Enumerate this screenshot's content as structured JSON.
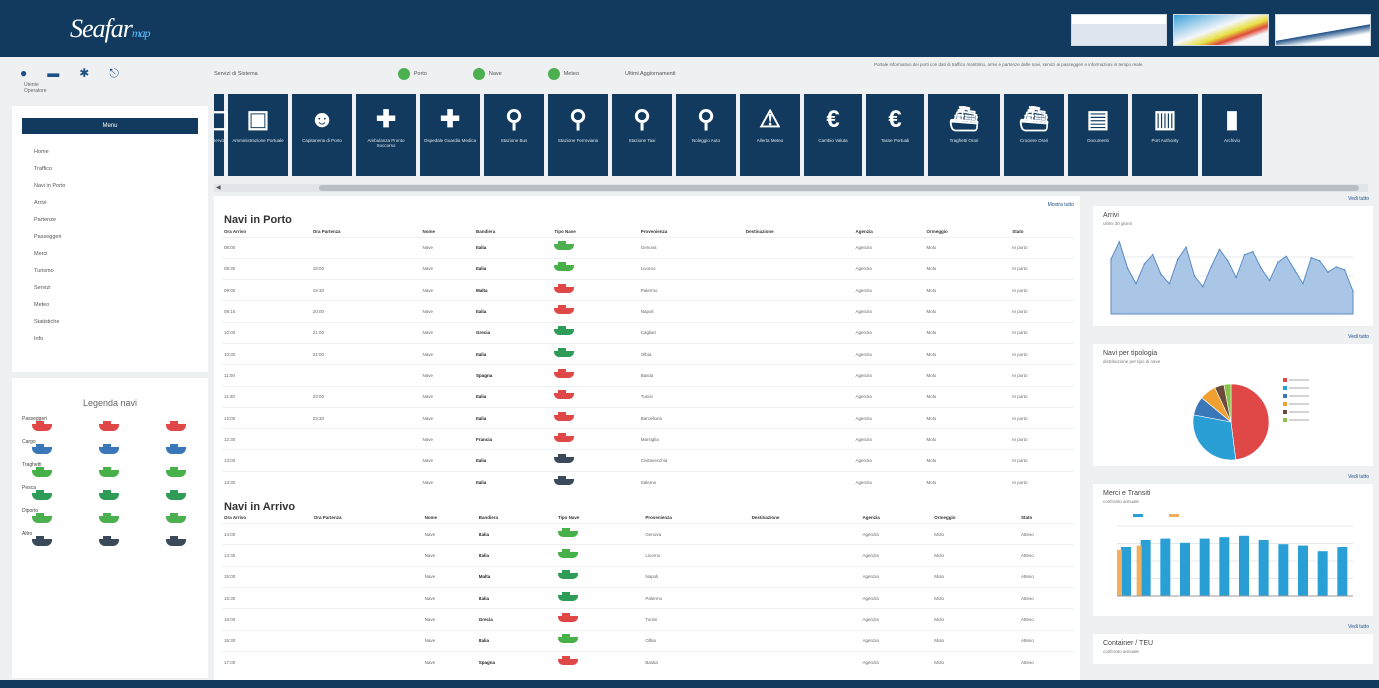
{
  "header": {
    "logo_main": "Seafar",
    "logo_suffix": "map"
  },
  "partners": [
    "partner-logo-1",
    "partner-logo-2",
    "partner-logo-3"
  ],
  "status": {
    "label_left": "Servizi di Sistema",
    "services": [
      "Porto",
      "Nave",
      "Meteo"
    ],
    "label_right": "Ultimi Aggiornamenti",
    "news": "Portale informativo dei porti con dati di traffico marittimo, arrivi e partenze delle navi, servizi ai passeggeri e informazioni in tempo reale."
  },
  "user": {
    "name": "Utente",
    "role": "Operatore"
  },
  "sidebar": {
    "header": "Menu",
    "items": [
      "Home",
      "Traffico",
      "Navi in Porto",
      "Arrivi",
      "Partenze",
      "Passeggeri",
      "Merci",
      "Turismo",
      "Servizi",
      "Meteo",
      "Statistiche",
      "Info"
    ]
  },
  "legend": {
    "title": "Legenda navi",
    "groups": [
      {
        "name": "Passeggeri",
        "color": "#e04848"
      },
      {
        "name": "Cargo",
        "color": "#3a77b8"
      },
      {
        "name": "Traghetti",
        "color": "#48b048"
      },
      {
        "name": "Pesca",
        "color": "#2e9c56"
      },
      {
        "name": "Diporto",
        "color": "#4caf50"
      },
      {
        "name": "Altro",
        "color": "#3a4a5a"
      }
    ]
  },
  "toolbar": [
    {
      "icon": "▢",
      "label": "Servizi"
    },
    {
      "icon": "▣",
      "label": "Amministrazione Portuale"
    },
    {
      "icon": "☻",
      "label": "Capitaneria di Porto"
    },
    {
      "icon": "✚",
      "label": "Ambulanza Pronto Soccorso"
    },
    {
      "icon": "✚",
      "label": "Ospedale Guardia Medica"
    },
    {
      "icon": "⚲",
      "label": "Stazione Bus"
    },
    {
      "icon": "⚲",
      "label": "Stazione Ferroviaria"
    },
    {
      "icon": "⚲",
      "label": "Stazione Taxi"
    },
    {
      "icon": "⚲",
      "label": "Noleggio Auto"
    },
    {
      "icon": "⚠",
      "label": "Allerta Meteo"
    },
    {
      "icon": "€",
      "label": "Cambio Valuta"
    },
    {
      "icon": "€",
      "label": "Tasse Portuali"
    },
    {
      "icon": "⛴",
      "label": "Traghetti Orari"
    },
    {
      "icon": "⛴",
      "label": "Crociere Orari"
    },
    {
      "icon": "▤",
      "label": "Documenti"
    },
    {
      "icon": "▥",
      "label": "Port Authority"
    },
    {
      "icon": "▮",
      "label": "Archivio"
    }
  ],
  "main": {
    "link": "Mostra tutto",
    "in_port": {
      "title": "Navi in Porto",
      "columns": [
        "Ora Arrivo",
        "Ora Partenza",
        "Nome",
        "Bandiera",
        "Tipo Nave",
        "Provenienza",
        "Destinazione",
        "Agenzia",
        "Ormeggio",
        "Stato"
      ],
      "rows": [
        {
          "cells": [
            "08:00",
            "",
            "Nave",
            "Italia",
            "",
            "Genova",
            "",
            "Agenzia",
            "Molo",
            "In porto"
          ],
          "ship": "#4caf50"
        },
        {
          "cells": [
            "08:30",
            "18:00",
            "Nave",
            "Italia",
            "",
            "Livorno",
            "",
            "Agenzia",
            "Molo",
            "In porto"
          ],
          "ship": "#48b048"
        },
        {
          "cells": [
            "09:00",
            "19:30",
            "Nave",
            "Malta",
            "",
            "Palermo",
            "",
            "Agenzia",
            "Molo",
            "In porto"
          ],
          "ship": "#e04848"
        },
        {
          "cells": [
            "09:15",
            "20:00",
            "Nave",
            "Italia",
            "",
            "Napoli",
            "",
            "Agenzia",
            "Molo",
            "In porto"
          ],
          "ship": "#e04848"
        },
        {
          "cells": [
            "10:00",
            "21:00",
            "Nave",
            "Grecia",
            "",
            "Cagliari",
            "",
            "Agenzia",
            "Molo",
            "In porto"
          ],
          "ship": "#2e9c56"
        },
        {
          "cells": [
            "10:30",
            "22:00",
            "Nave",
            "Italia",
            "",
            "Olbia",
            "",
            "Agenzia",
            "Molo",
            "In porto"
          ],
          "ship": "#2e9c56"
        },
        {
          "cells": [
            "11:00",
            "",
            "Nave",
            "Spagna",
            "",
            "Bastia",
            "",
            "Agenzia",
            "Molo",
            "In porto"
          ],
          "ship": "#e04848"
        },
        {
          "cells": [
            "11:30",
            "23:00",
            "Nave",
            "Italia",
            "",
            "Tunisi",
            "",
            "Agenzia",
            "Molo",
            "In porto"
          ],
          "ship": "#e04848"
        },
        {
          "cells": [
            "12:00",
            "23:30",
            "Nave",
            "Italia",
            "",
            "Barcellona",
            "",
            "Agenzia",
            "Molo",
            "In porto"
          ],
          "ship": "#e04848"
        },
        {
          "cells": [
            "12:30",
            "",
            "Nave",
            "Francia",
            "",
            "Marsiglia",
            "",
            "Agenzia",
            "Molo",
            "In porto"
          ],
          "ship": "#e04848"
        },
        {
          "cells": [
            "13:00",
            "",
            "Nave",
            "Italia",
            "",
            "Civitavecchia",
            "",
            "Agenzia",
            "Molo",
            "In porto"
          ],
          "ship": "#3a4a5a"
        },
        {
          "cells": [
            "13:30",
            "",
            "Nave",
            "Italia",
            "",
            "Salerno",
            "",
            "Agenzia",
            "Molo",
            "In porto"
          ],
          "ship": "#3a4a5a"
        }
      ]
    },
    "arrivals": {
      "title": "Navi in Arrivo",
      "columns": [
        "Ora Arrivo",
        "Ora Partenza",
        "Nome",
        "Bandiera",
        "Tipo Nave",
        "Provenienza",
        "Destinazione",
        "Agenzia",
        "Ormeggio",
        "Stato"
      ],
      "rows": [
        {
          "cells": [
            "14:00",
            "",
            "Nave",
            "Italia",
            "",
            "Genova",
            "",
            "Agenzia",
            "Molo",
            "Atteso"
          ],
          "ship": "#48b048"
        },
        {
          "cells": [
            "14:30",
            "",
            "Nave",
            "Italia",
            "",
            "Livorno",
            "",
            "Agenzia",
            "Molo",
            "Atteso"
          ],
          "ship": "#48b048"
        },
        {
          "cells": [
            "15:00",
            "",
            "Nave",
            "Malta",
            "",
            "Napoli",
            "",
            "Agenzia",
            "Molo",
            "Atteso"
          ],
          "ship": "#2e9c56"
        },
        {
          "cells": [
            "15:30",
            "",
            "Nave",
            "Italia",
            "",
            "Palermo",
            "",
            "Agenzia",
            "Molo",
            "Atteso"
          ],
          "ship": "#2e9c56"
        },
        {
          "cells": [
            "16:00",
            "",
            "Nave",
            "Grecia",
            "",
            "Tunisi",
            "",
            "Agenzia",
            "Molo",
            "Atteso"
          ],
          "ship": "#e04848"
        },
        {
          "cells": [
            "16:30",
            "",
            "Nave",
            "Italia",
            "",
            "Olbia",
            "",
            "Agenzia",
            "Molo",
            "Atteso"
          ],
          "ship": "#48b048"
        },
        {
          "cells": [
            "17:00",
            "",
            "Nave",
            "Spagna",
            "",
            "Bastia",
            "",
            "Agenzia",
            "Molo",
            "Atteso"
          ],
          "ship": "#e04848"
        }
      ]
    }
  },
  "right": {
    "link_top": "Vedi tutto",
    "area": {
      "title": "Arrivi",
      "subtitle": "ultimi 30 giorni"
    },
    "pie": {
      "title": "Navi per tipologia",
      "subtitle": "distribuzione per tipo di nave",
      "link": "Vedi tutto"
    },
    "bars": {
      "title": "Merci e Transiti",
      "subtitle": "confronto annuale",
      "link": "Vedi tutto"
    },
    "bottom": {
      "title": "Container / TEU",
      "subtitle": "confronto annuale",
      "link": "Vedi tutto"
    }
  },
  "chart_data": [
    {
      "type": "area",
      "x": [
        1,
        2,
        3,
        4,
        5,
        6,
        7,
        8,
        9,
        10,
        11,
        12,
        13,
        14,
        15,
        16,
        17,
        18,
        19,
        20,
        21,
        22,
        23,
        24,
        25,
        26,
        27,
        28,
        29,
        30
      ],
      "values": [
        72,
        95,
        60,
        40,
        66,
        78,
        52,
        40,
        72,
        88,
        50,
        36,
        62,
        85,
        70,
        48,
        78,
        82,
        60,
        44,
        68,
        76,
        58,
        40,
        74,
        70,
        55,
        62,
        58,
        30
      ],
      "ylim": [
        0,
        100
      ]
    },
    {
      "type": "pie",
      "series": [
        {
          "label": "",
          "value": 48,
          "color": "#e04848"
        },
        {
          "label": "",
          "value": 30,
          "color": "#2a9fd6"
        },
        {
          "label": "",
          "value": 8,
          "color": "#3a77b8"
        },
        {
          "label": "",
          "value": 7,
          "color": "#f0a030"
        },
        {
          "label": "",
          "value": 4,
          "color": "#6b4a3a"
        },
        {
          "label": "",
          "value": 3,
          "color": "#8bc34a"
        }
      ]
    },
    {
      "type": "bar",
      "categories": [
        "",
        "",
        "",
        "",
        "",
        "",
        "",
        "",
        "",
        "",
        "",
        ""
      ],
      "series": [
        {
          "values": [
            70,
            80,
            82,
            76,
            82,
            84,
            86,
            80,
            74,
            72,
            64,
            70
          ],
          "color": "#2a9fd6"
        },
        {
          "values": [
            66,
            72,
            0,
            0,
            0,
            0,
            0,
            0,
            0,
            0,
            0,
            0
          ],
          "color": "#f0b060"
        }
      ],
      "ylim": [
        0,
        100
      ]
    }
  ]
}
